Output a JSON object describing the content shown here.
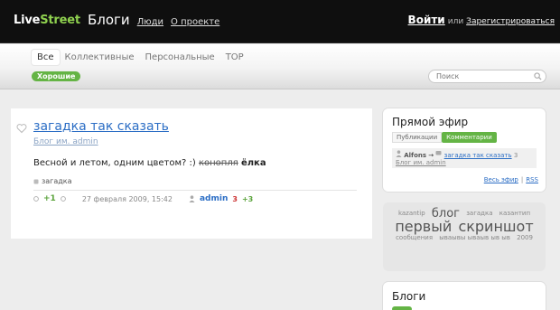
{
  "header": {
    "logo_part1": "Live",
    "logo_part2": "Street",
    "nav_blogs": "Блоги",
    "nav_people": "Люди",
    "nav_about": "О проекте",
    "login": "Войти",
    "or": "или",
    "register": "Зарегистрироваться"
  },
  "subnav": {
    "tabs": [
      "Все",
      "Коллективные",
      "Персональные",
      "TOP"
    ],
    "active_tab": "Все",
    "badge": "Хорошие",
    "search_placeholder": "Поиск"
  },
  "post": {
    "title": "загадка так сказать",
    "blog": "Блог им. admin",
    "text_start": "Весной и летом, одним цветом? :) ",
    "text_strike": "конопля",
    "text_bold": "ёлка",
    "tag": "загадка",
    "vote": "+1",
    "date": "27 февраля 2009, 15:42",
    "author": "admin",
    "comments": "3",
    "comments_new": "+3"
  },
  "live": {
    "title": "Прямой эфир",
    "tab_posts": "Публикации",
    "tab_comments": "Комментарии",
    "item_user": "Alfons",
    "item_arrow": "→",
    "item_post": "загадка так сказать",
    "item_comments": "3",
    "item_blog": "Блог им. admin",
    "link_all": "Весь эфир",
    "link_sep": "|",
    "link_rss": "RSS"
  },
  "cloud": {
    "tags": [
      {
        "text": "kazantip",
        "size": 1
      },
      {
        "text": "блог",
        "size": 2
      },
      {
        "text": "загадка",
        "size": 1
      },
      {
        "text": "казантип",
        "size": 1
      },
      {
        "text": "первый",
        "size": 2
      },
      {
        "text": "скриншот",
        "size": 3
      },
      {
        "text": "сообщения",
        "size": 1
      },
      {
        "text": "ываывы ываыв ыв ыв",
        "size": 1
      },
      {
        "text": "2009",
        "size": 1
      }
    ]
  },
  "blogs": {
    "title": "Блоги"
  },
  "colors": {
    "accent_green": "#64b445",
    "link_blue": "#2c6ec5",
    "header_black": "#0f0f0f"
  }
}
